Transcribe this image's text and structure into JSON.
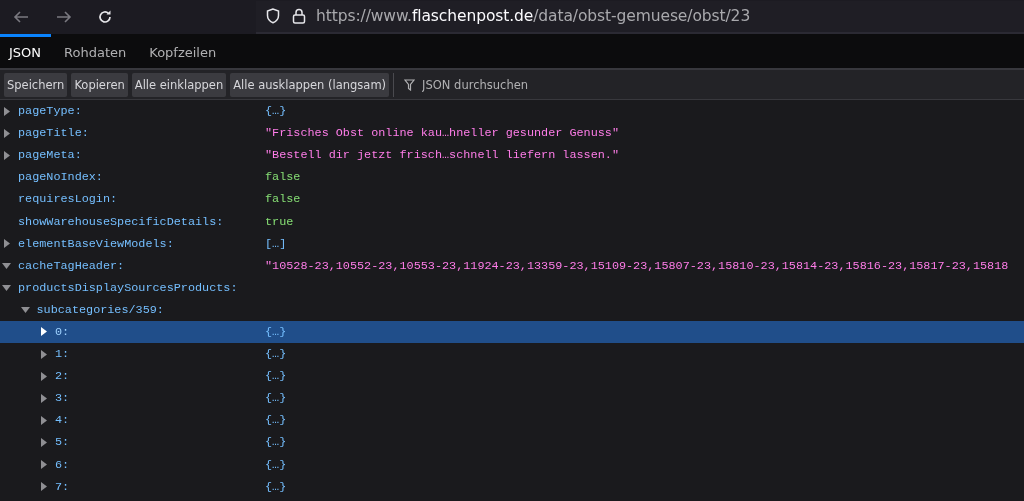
{
  "browser": {
    "url_prefix": "https://www.",
    "url_domain": "flaschenpost.de",
    "url_path": "/data/obst-gemuese/obst/23"
  },
  "tabs": [
    {
      "label": "JSON",
      "selected": true
    },
    {
      "label": "Rohdaten",
      "selected": false
    },
    {
      "label": "Kopfzeilen",
      "selected": false
    }
  ],
  "toolbar": {
    "buttons": [
      "Speichern",
      "Kopieren",
      "Alle einklappen",
      "Alle ausklappen (langsam)"
    ],
    "filter_placeholder": "JSON durchsuchen"
  },
  "tree": [
    {
      "key": "pageType:",
      "value": "{…}",
      "kind": "object",
      "expanded": false,
      "selected": false
    },
    {
      "key": "pageTitle:",
      "value": "\"Frisches Obst online kau…hneller gesunder Genuss\"",
      "kind": "string",
      "expanded": false,
      "selected": false
    },
    {
      "key": "pageMeta:",
      "value": "\"Bestell dir jetzt frisch…schnell liefern lassen.\"",
      "kind": "string",
      "expanded": false,
      "selected": false
    },
    {
      "key": "pageNoIndex:",
      "value": "false",
      "kind": "boolean",
      "selected": false
    },
    {
      "key": "requiresLogin:",
      "value": "false",
      "kind": "boolean",
      "selected": false
    },
    {
      "key": "showWarehouseSpecificDetails:",
      "value": "true",
      "kind": "boolean",
      "selected": false
    },
    {
      "key": "elementBaseViewModels:",
      "value": "[…]",
      "kind": "array",
      "expanded": false,
      "selected": false
    },
    {
      "key": "cacheTagHeader:",
      "value": "\"10528-23,10552-23,10553-23,11924-23,13359-23,15109-23,15807-23,15810-23,15814-23,15816-23,15817-23,15818",
      "kind": "string",
      "expanded": true,
      "selected": false
    },
    {
      "key": "productsDisplaySourcesProducts:",
      "expanded": true,
      "selected": false,
      "children": [
        {
          "key": "subcategories/359:",
          "expanded": true,
          "selected": false,
          "children": [
            {
              "key": "0:",
              "value": "{…}",
              "kind": "object",
              "expanded": false,
              "selected": true
            },
            {
              "key": "1:",
              "value": "{…}",
              "kind": "object",
              "expanded": false,
              "selected": false
            },
            {
              "key": "2:",
              "value": "{…}",
              "kind": "object",
              "expanded": false,
              "selected": false
            },
            {
              "key": "3:",
              "value": "{…}",
              "kind": "object",
              "expanded": false,
              "selected": false
            },
            {
              "key": "4:",
              "value": "{…}",
              "kind": "object",
              "expanded": false,
              "selected": false
            },
            {
              "key": "5:",
              "value": "{…}",
              "kind": "object",
              "expanded": false,
              "selected": false
            },
            {
              "key": "6:",
              "value": "{…}",
              "kind": "object",
              "expanded": false,
              "selected": false
            },
            {
              "key": "7:",
              "value": "{…}",
              "kind": "object",
              "expanded": false,
              "selected": false
            }
          ]
        }
      ]
    }
  ]
}
